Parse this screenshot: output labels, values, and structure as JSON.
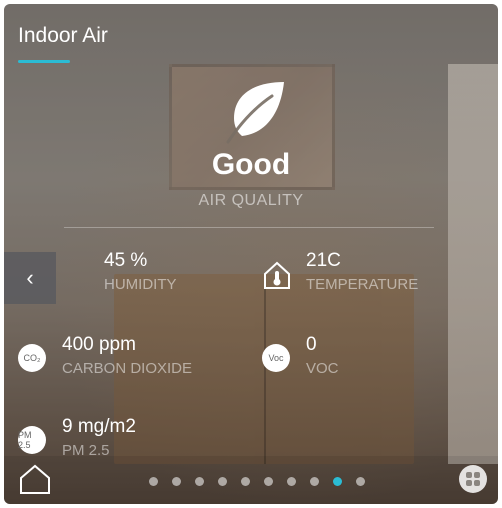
{
  "header": {
    "title": "Indoor Air"
  },
  "air_quality": {
    "status": "Good",
    "label": "AIR QUALITY"
  },
  "metrics": {
    "humidity": {
      "value": "45 %",
      "label": "HUMIDITY",
      "icon": "water-drop-icon"
    },
    "temperature": {
      "value": "21C",
      "label": "TEMPERATURE",
      "icon": "thermometer-icon"
    },
    "co2": {
      "value": "400 ppm",
      "label": "CARBON DIOXIDE",
      "icon_text": "CO₂"
    },
    "voc": {
      "value": "0",
      "label": "VOC",
      "icon_text": "Voc"
    },
    "pm25": {
      "value": "9 mg/m2",
      "label": "PM 2.5",
      "icon_text": "PM 2.5"
    }
  },
  "pagination": {
    "total": 10,
    "active_index": 8
  },
  "colors": {
    "accent": "#2bbcd4"
  }
}
